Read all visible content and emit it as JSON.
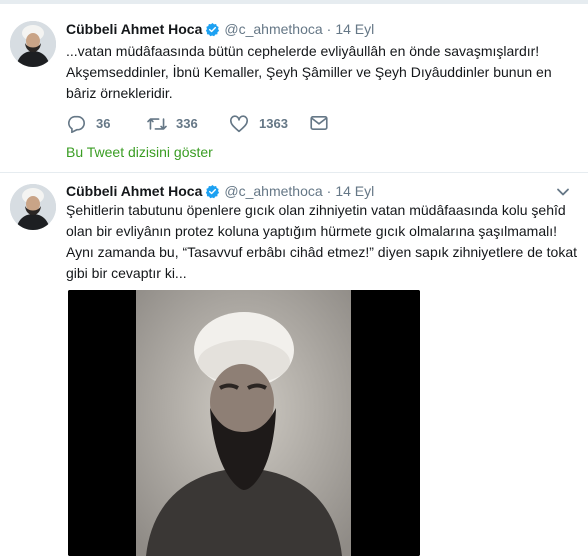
{
  "tweets": [
    {
      "author_name": "Cübbeli Ahmet Hoca",
      "handle": "@c_ahmethoca",
      "separator": "·",
      "date": "14 Eyl",
      "text_lines": [
        "...vatan müdâfaasında bütün cephelerde evliyâullâh en önde savaşmışlardır!",
        "Akşemseddinler, İbnü Kemaller, Şeyh Şâmiller ve Şeyh Dıyâuddinler bunun en",
        "bâriz örnekleridir."
      ],
      "replies": "36",
      "retweets": "336",
      "likes": "1363",
      "thread_link": "Bu Tweet dizisini göster"
    },
    {
      "author_name": "Cübbeli Ahmet Hoca",
      "handle": "@c_ahmethoca",
      "separator": "·",
      "date": "14 Eyl",
      "text_lines": [
        "Şehitlerin tabutunu öpenlere gıcık olan zihniyetin vatan müdâfaasında kolu şehîd",
        "olan bir evliyânın protez koluna yaptığım hürmete gıcık olmalarına şaşılmamalı!",
        "Aynı zamanda bu, “Tasavvuf erbâbı cihâd etmez!” diyen sapık zihniyetlere de tokat",
        "gibi bir cevaptır ki..."
      ]
    }
  ],
  "icons": {
    "verified_color": "#1da1f2",
    "link_color": "#3a9d23",
    "action_color": "#657786"
  }
}
